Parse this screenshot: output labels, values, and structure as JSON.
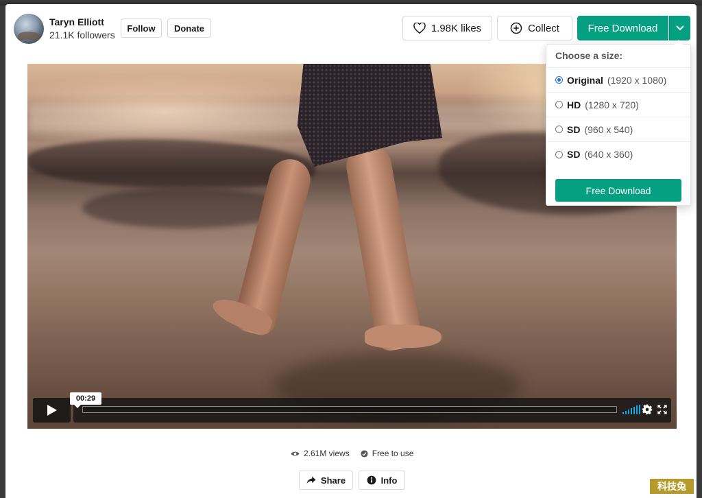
{
  "author": {
    "name": "Taryn Elliott",
    "followers": "21.1K followers"
  },
  "header": {
    "follow_label": "Follow",
    "donate_label": "Donate",
    "likes_label": "1.98K likes",
    "collect_label": "Collect",
    "download_label": "Free Download"
  },
  "player": {
    "current_time": "00:29",
    "progress": 0.0
  },
  "size_menu": {
    "title": "Choose a size:",
    "options": [
      {
        "name": "Original",
        "dims": "(1920 x 1080)",
        "selected": true
      },
      {
        "name": "HD",
        "dims": "(1280 x 720)",
        "selected": false
      },
      {
        "name": "SD",
        "dims": "(960 x 540)",
        "selected": false
      },
      {
        "name": "SD",
        "dims": "(640 x 360)",
        "selected": false
      }
    ],
    "download_label": "Free Download"
  },
  "stats": {
    "views": "2.61M views",
    "license": "Free to use"
  },
  "footer": {
    "share_label": "Share",
    "info_label": "Info"
  },
  "watermark": "科技兔",
  "colors": {
    "accent": "#05a081",
    "radio_selected": "#1a73e8",
    "volume": "#1aa7e0"
  }
}
